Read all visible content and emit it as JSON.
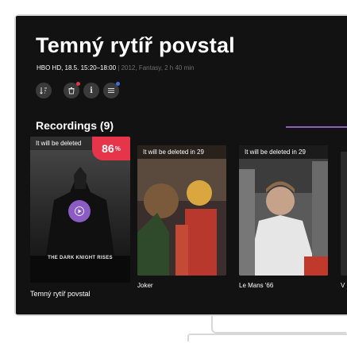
{
  "details": {
    "title": "Temný rytíř povstal",
    "meta_channel": "HBO HD, 18.5. 15:20–18:00",
    "meta_extra": " | 2012, Fantasy, 2 h 40 min"
  },
  "actions": [
    {
      "icon": "sort-icon",
      "glyph": "⇅"
    },
    {
      "icon": "trash-icon",
      "glyph": "🗑",
      "dot_color": "#e6344a"
    },
    {
      "icon": "info-icon",
      "glyph": "i"
    },
    {
      "icon": "menu-icon",
      "glyph": "≡",
      "dot_color": "#3f6fd8"
    }
  ],
  "recordings": {
    "header": "Recordings (9)",
    "featured": {
      "title": "Temný rytíř povstal",
      "badge": "It will be deleted",
      "progress_value": "86",
      "progress_unit": "%",
      "poster_text": "THE DARK KNIGHT RISES"
    },
    "items": [
      {
        "title": "Joker",
        "badge": "It will be deleted in 29"
      },
      {
        "title": "Le Mans '66",
        "badge": "It will be deleted in 29"
      },
      {
        "title": "V",
        "badge": ""
      }
    ]
  },
  "colors": {
    "accent": "#8a5cc4",
    "progress": "#e6344a",
    "background": "#121212"
  }
}
